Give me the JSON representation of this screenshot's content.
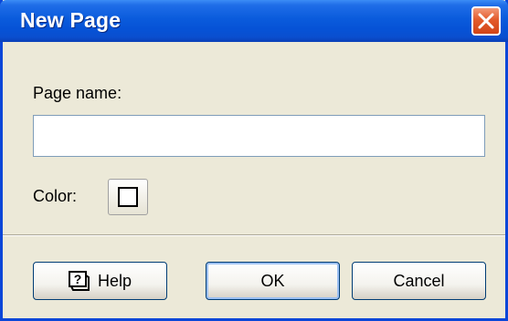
{
  "dialog": {
    "title": "New Page",
    "close_icon": "close-icon"
  },
  "form": {
    "page_name_label": "Page name:",
    "page_name_value": "",
    "color_label": "Color:",
    "color_value": "#ffffff"
  },
  "buttons": {
    "help_label": "Help",
    "help_icon": "help-icon",
    "ok_label": "OK",
    "cancel_label": "Cancel"
  },
  "colors": {
    "titlebar": "#0a5bdc",
    "dialog_background": "#ece9d8",
    "close_button": "#e35b2c"
  }
}
